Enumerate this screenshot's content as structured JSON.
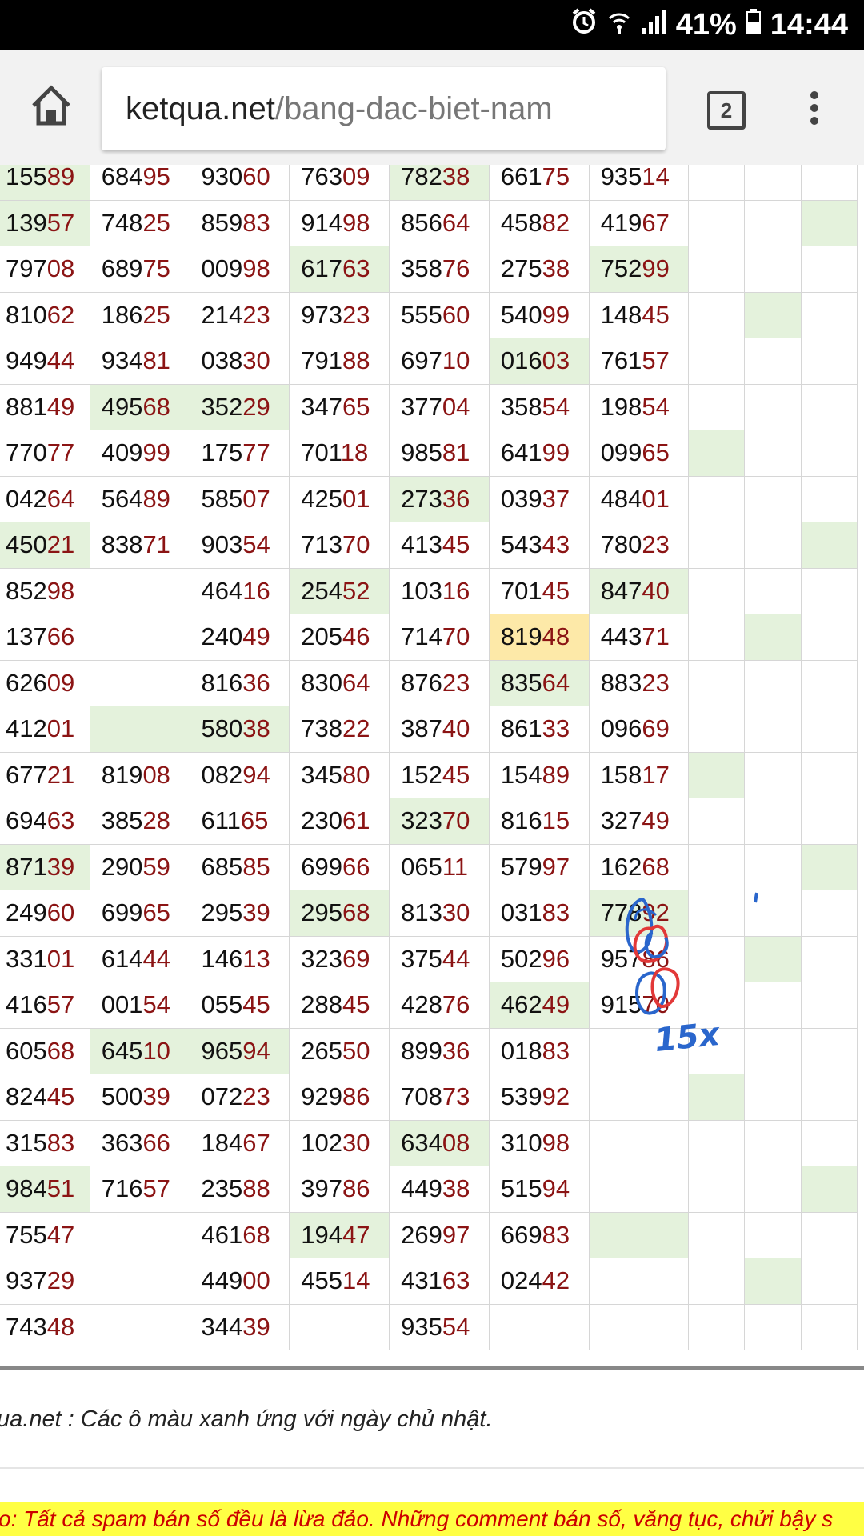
{
  "status_bar": {
    "battery": "41%",
    "time": "14:44"
  },
  "browser": {
    "url_domain": "ketqua.net",
    "url_path": "/bang-dac-biet-nam",
    "tab_count": "2"
  },
  "table": {
    "rows": [
      [
        [
          "15589",
          "g"
        ],
        [
          "68495",
          ""
        ],
        [
          "93060",
          ""
        ],
        [
          "76309",
          ""
        ],
        [
          "78238",
          "g"
        ],
        [
          "66175",
          ""
        ],
        [
          "93514",
          ""
        ],
        [
          "",
          ""
        ],
        [
          "",
          ""
        ],
        [
          "",
          ""
        ]
      ],
      [
        [
          "13957",
          "g"
        ],
        [
          "74825",
          ""
        ],
        [
          "85983",
          ""
        ],
        [
          "91498",
          ""
        ],
        [
          "85664",
          ""
        ],
        [
          "45882",
          ""
        ],
        [
          "41967",
          ""
        ],
        [
          "",
          ""
        ],
        [
          "",
          ""
        ],
        [
          "",
          "g"
        ]
      ],
      [
        [
          "79708",
          ""
        ],
        [
          "68975",
          ""
        ],
        [
          "00998",
          ""
        ],
        [
          "61763",
          "g"
        ],
        [
          "35876",
          ""
        ],
        [
          "27538",
          ""
        ],
        [
          "75299",
          "g"
        ],
        [
          "",
          ""
        ],
        [
          "",
          ""
        ],
        [
          "",
          ""
        ]
      ],
      [
        [
          "81062",
          ""
        ],
        [
          "18625",
          ""
        ],
        [
          "21423",
          ""
        ],
        [
          "97323",
          ""
        ],
        [
          "55560",
          ""
        ],
        [
          "54099",
          ""
        ],
        [
          "14845",
          ""
        ],
        [
          "",
          ""
        ],
        [
          "",
          "g"
        ],
        [
          "",
          ""
        ]
      ],
      [
        [
          "94944",
          ""
        ],
        [
          "93481",
          ""
        ],
        [
          "03830",
          ""
        ],
        [
          "79188",
          ""
        ],
        [
          "69710",
          ""
        ],
        [
          "01603",
          "g"
        ],
        [
          "76157",
          ""
        ],
        [
          "",
          ""
        ],
        [
          "",
          ""
        ],
        [
          "",
          ""
        ]
      ],
      [
        [
          "88149",
          ""
        ],
        [
          "49568",
          "g"
        ],
        [
          "35229",
          "g"
        ],
        [
          "34765",
          ""
        ],
        [
          "37704",
          ""
        ],
        [
          "35854",
          ""
        ],
        [
          "19854",
          ""
        ],
        [
          "",
          ""
        ],
        [
          "",
          ""
        ],
        [
          "",
          ""
        ]
      ],
      [
        [
          "77077",
          ""
        ],
        [
          "40999",
          ""
        ],
        [
          "17577",
          ""
        ],
        [
          "70118",
          ""
        ],
        [
          "98581",
          ""
        ],
        [
          "64199",
          ""
        ],
        [
          "09965",
          ""
        ],
        [
          "",
          "g"
        ],
        [
          "",
          ""
        ],
        [
          "",
          ""
        ]
      ],
      [
        [
          "04264",
          ""
        ],
        [
          "56489",
          ""
        ],
        [
          "58507",
          ""
        ],
        [
          "42501",
          ""
        ],
        [
          "27336",
          "g"
        ],
        [
          "03937",
          ""
        ],
        [
          "48401",
          ""
        ],
        [
          "",
          ""
        ],
        [
          "",
          ""
        ],
        [
          "",
          ""
        ]
      ],
      [
        [
          "45021",
          "g"
        ],
        [
          "83871",
          ""
        ],
        [
          "90354",
          ""
        ],
        [
          "71370",
          ""
        ],
        [
          "41345",
          ""
        ],
        [
          "54343",
          ""
        ],
        [
          "78023",
          ""
        ],
        [
          "",
          ""
        ],
        [
          "",
          ""
        ],
        [
          "",
          "g"
        ]
      ],
      [
        [
          "85298",
          ""
        ],
        [
          "",
          ""
        ],
        [
          "46416",
          ""
        ],
        [
          "25452",
          "g"
        ],
        [
          "10316",
          ""
        ],
        [
          "70145",
          ""
        ],
        [
          "84740",
          "g"
        ],
        [
          "",
          ""
        ],
        [
          "",
          ""
        ],
        [
          "",
          ""
        ]
      ],
      [
        [
          "13766",
          ""
        ],
        [
          "",
          ""
        ],
        [
          "24049",
          ""
        ],
        [
          "20546",
          ""
        ],
        [
          "71470",
          ""
        ],
        [
          "81948",
          "y"
        ],
        [
          "44371",
          ""
        ],
        [
          "",
          ""
        ],
        [
          "",
          "g"
        ],
        [
          "",
          ""
        ]
      ],
      [
        [
          "62609",
          ""
        ],
        [
          "",
          ""
        ],
        [
          "81636",
          ""
        ],
        [
          "83064",
          ""
        ],
        [
          "87623",
          ""
        ],
        [
          "83564",
          "g"
        ],
        [
          "88323",
          ""
        ],
        [
          "",
          ""
        ],
        [
          "",
          ""
        ],
        [
          "",
          ""
        ]
      ],
      [
        [
          "41201",
          ""
        ],
        [
          "",
          "g"
        ],
        [
          "58038",
          "g"
        ],
        [
          "73822",
          ""
        ],
        [
          "38740",
          ""
        ],
        [
          "86133",
          ""
        ],
        [
          "09669",
          ""
        ],
        [
          "",
          ""
        ],
        [
          "",
          ""
        ],
        [
          "",
          ""
        ]
      ],
      [
        [
          "67721",
          ""
        ],
        [
          "81908",
          ""
        ],
        [
          "08294",
          ""
        ],
        [
          "34580",
          ""
        ],
        [
          "15245",
          ""
        ],
        [
          "15489",
          ""
        ],
        [
          "15817",
          ""
        ],
        [
          "",
          "g"
        ],
        [
          "",
          ""
        ],
        [
          "",
          ""
        ]
      ],
      [
        [
          "69463",
          ""
        ],
        [
          "38528",
          ""
        ],
        [
          "61165",
          ""
        ],
        [
          "23061",
          ""
        ],
        [
          "32370",
          "g"
        ],
        [
          "81615",
          ""
        ],
        [
          "32749",
          ""
        ],
        [
          "",
          ""
        ],
        [
          "",
          ""
        ],
        [
          "",
          ""
        ]
      ],
      [
        [
          "87139",
          "g"
        ],
        [
          "29059",
          ""
        ],
        [
          "68585",
          ""
        ],
        [
          "69966",
          ""
        ],
        [
          "06511",
          ""
        ],
        [
          "57997",
          ""
        ],
        [
          "16268",
          ""
        ],
        [
          "",
          ""
        ],
        [
          "",
          ""
        ],
        [
          "",
          "g"
        ]
      ],
      [
        [
          "24960",
          ""
        ],
        [
          "69965",
          ""
        ],
        [
          "29539",
          ""
        ],
        [
          "29568",
          "g"
        ],
        [
          "81330",
          ""
        ],
        [
          "03183",
          ""
        ],
        [
          "77892",
          "g"
        ],
        [
          "",
          ""
        ],
        [
          "",
          ""
        ],
        [
          "",
          ""
        ]
      ],
      [
        [
          "33101",
          ""
        ],
        [
          "61444",
          ""
        ],
        [
          "14613",
          ""
        ],
        [
          "32369",
          ""
        ],
        [
          "37544",
          ""
        ],
        [
          "50296",
          ""
        ],
        [
          "95786",
          ""
        ],
        [
          "",
          ""
        ],
        [
          "",
          "g"
        ],
        [
          "",
          ""
        ]
      ],
      [
        [
          "41657",
          ""
        ],
        [
          "00154",
          ""
        ],
        [
          "05545",
          ""
        ],
        [
          "28845",
          ""
        ],
        [
          "42876",
          ""
        ],
        [
          "46249",
          "g"
        ],
        [
          "91570",
          ""
        ],
        [
          "",
          ""
        ],
        [
          "",
          ""
        ],
        [
          "",
          ""
        ]
      ],
      [
        [
          "60568",
          ""
        ],
        [
          "64510",
          "g"
        ],
        [
          "96594",
          "g"
        ],
        [
          "26550",
          ""
        ],
        [
          "89936",
          ""
        ],
        [
          "01883",
          ""
        ],
        [
          "",
          ""
        ],
        [
          "",
          ""
        ],
        [
          "",
          ""
        ],
        [
          "",
          ""
        ]
      ],
      [
        [
          "82445",
          ""
        ],
        [
          "50039",
          ""
        ],
        [
          "07223",
          ""
        ],
        [
          "92986",
          ""
        ],
        [
          "70873",
          ""
        ],
        [
          "53992",
          ""
        ],
        [
          "",
          ""
        ],
        [
          "",
          "g"
        ],
        [
          "",
          ""
        ],
        [
          "",
          ""
        ]
      ],
      [
        [
          "31583",
          ""
        ],
        [
          "36366",
          ""
        ],
        [
          "18467",
          ""
        ],
        [
          "10230",
          ""
        ],
        [
          "63408",
          "g"
        ],
        [
          "31098",
          ""
        ],
        [
          "",
          ""
        ],
        [
          "",
          ""
        ],
        [
          "",
          ""
        ],
        [
          "",
          ""
        ]
      ],
      [
        [
          "98451",
          "g"
        ],
        [
          "71657",
          ""
        ],
        [
          "23588",
          ""
        ],
        [
          "39786",
          ""
        ],
        [
          "44938",
          ""
        ],
        [
          "51594",
          ""
        ],
        [
          "",
          ""
        ],
        [
          "",
          ""
        ],
        [
          "",
          ""
        ],
        [
          "",
          "g"
        ]
      ],
      [
        [
          "75547",
          ""
        ],
        [
          "",
          ""
        ],
        [
          "46168",
          ""
        ],
        [
          "19447",
          "g"
        ],
        [
          "26997",
          ""
        ],
        [
          "66983",
          ""
        ],
        [
          "",
          "g"
        ],
        [
          "",
          ""
        ],
        [
          "",
          ""
        ],
        [
          "",
          ""
        ]
      ],
      [
        [
          "93729",
          ""
        ],
        [
          "",
          ""
        ],
        [
          "44900",
          ""
        ],
        [
          "45514",
          ""
        ],
        [
          "43163",
          ""
        ],
        [
          "02442",
          ""
        ],
        [
          "",
          ""
        ],
        [
          "",
          ""
        ],
        [
          "",
          "g"
        ],
        [
          "",
          ""
        ]
      ],
      [
        [
          "74348",
          ""
        ],
        [
          "",
          ""
        ],
        [
          "34439",
          ""
        ],
        [
          "",
          ""
        ],
        [
          "93554",
          ""
        ],
        [
          "",
          ""
        ],
        [
          "",
          ""
        ],
        [
          "",
          ""
        ],
        [
          "",
          ""
        ],
        [
          "",
          ""
        ]
      ]
    ]
  },
  "handwritten_annotation": "15x",
  "footer": {
    "note": "ua.net : Các ô màu xanh ứng với ngày chủ nhật.",
    "warning": "o: Tất cả spam bán số đều là lừa đảo. Những comment bán số, văng tục, chửi bậy s"
  },
  "colors": {
    "sunday_green": "#e4f2dc",
    "highlight_yellow": "#fde9a8",
    "last_digits_red": "#8b1414",
    "warning_bg": "#ffff44",
    "warning_text": "#cc0000"
  }
}
